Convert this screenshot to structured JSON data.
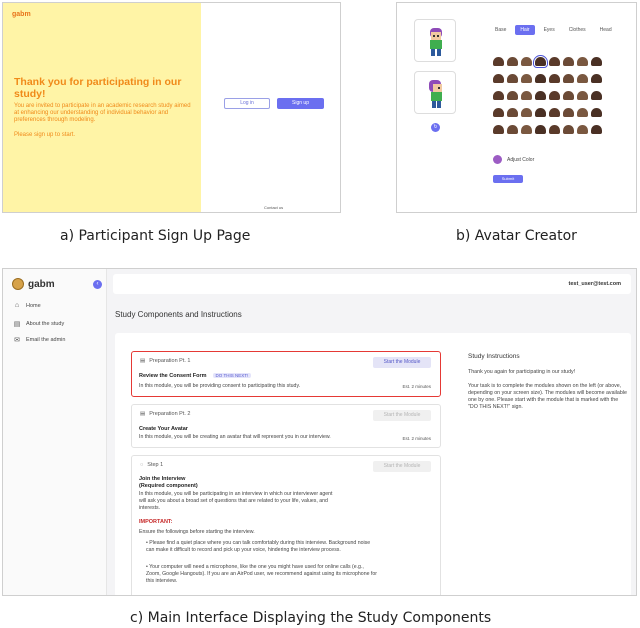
{
  "captions": {
    "a": "a) Participant Sign Up Page",
    "b": "b) Avatar Creator",
    "c": "c) Main Interface Displaying the Study Components"
  },
  "signup": {
    "brand": "gabm",
    "heading": "Thank you for participating in our study!",
    "description": "You are invited to participate in an academic research study aimed at enhancing our understanding of individual behavior and preferences through modeling.",
    "cta": "Please sign up to start.",
    "login_label": "Log in",
    "signup_label": "Sign up",
    "footer": "Contact us"
  },
  "avatar": {
    "tabs": [
      {
        "label": "Base",
        "active": false
      },
      {
        "label": "Hair",
        "active": true
      },
      {
        "label": "Eyes",
        "active": false
      },
      {
        "label": "Clothes",
        "active": false
      },
      {
        "label": "Head",
        "active": false
      }
    ],
    "adjust_color_label": "Adjust Color",
    "submit_label": "Submit",
    "accent": "#6b6ff0"
  },
  "main": {
    "logo": "gabm",
    "nav": [
      {
        "label": "Home",
        "icon": "house-icon",
        "glyph": "⌂"
      },
      {
        "label": "About the study",
        "icon": "document-icon",
        "glyph": "▤"
      },
      {
        "label": "Email the admin",
        "icon": "mail-icon",
        "glyph": "✉"
      }
    ],
    "user": "test_user@test.com",
    "page_title": "Study Components and Instructions",
    "cards": [
      {
        "header": "Preparation Pt. 1",
        "title": "Review the Consent Form",
        "tag": "DO THIS NEXT!",
        "description": "In this module, you will be providing consent to participating this study.",
        "time": "Est. 2 minutes",
        "button": "Start the Module"
      },
      {
        "header": "Preparation Pt. 2",
        "title": "Create Your Avatar",
        "description": "In this module, you will be creating an avatar that will represent you in our interview.",
        "time": "Est. 2 minutes",
        "button": "Start the Module"
      },
      {
        "header": "Step 1",
        "title": "Join the Interview",
        "subtitle": "(Required component)",
        "description_lines": [
          "In this module, you will be participating in an interview in which our interviewer agent",
          "will ask you about a broad set of questions that are related to your life, values, and",
          "interests."
        ],
        "important": "IMPORTANT:",
        "ensure": "Ensure the followings before starting the interview.",
        "bullets": [
          "• Please find a quiet place where you can talk comfortably during this interview. Background noise can make it difficult to record and pick up your voice, hindering the interview process.",
          "• Your computer will need a microphone, like the one you might have used for online calls (e.g., Zoom, Google Hangouts). If you are an AirPod user, we recommend against using its microphone for this interview."
        ],
        "button": "Start the Module"
      }
    ],
    "instructions": {
      "title": "Study Instructions",
      "p1": "Thank you again for participating in our study!",
      "p2": "Your task is to complete the modules shown on the left (or above, depending on your screen size). The modules will become available one by one. Please start with the module that is marked with the \"DO THIS NEXT!\" sign."
    }
  }
}
